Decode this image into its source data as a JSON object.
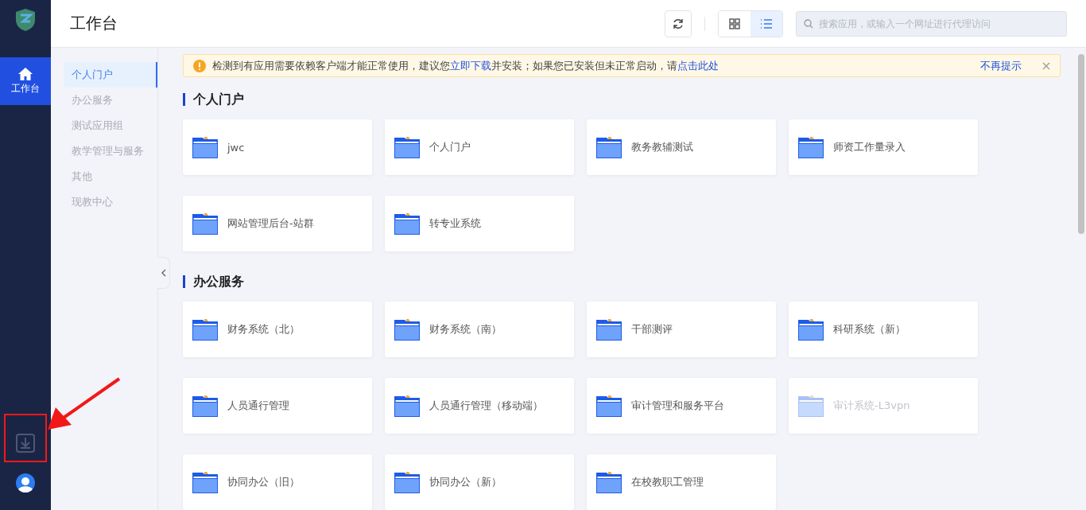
{
  "nav": {
    "items": [
      {
        "label": "工作台",
        "selected": true
      }
    ]
  },
  "header": {
    "title": "工作台",
    "search": {
      "placeholder": "搜索应用，或输入一个网址进行代理访问"
    },
    "views": [
      {
        "kind": "grid",
        "selected": false
      },
      {
        "kind": "list",
        "selected": true
      }
    ]
  },
  "categories": [
    {
      "label": "个人门户",
      "selected": true
    },
    {
      "label": "办公服务",
      "selected": false
    },
    {
      "label": "测试应用组",
      "selected": false
    },
    {
      "label": "教学管理与服务",
      "selected": false
    },
    {
      "label": "其他",
      "selected": false
    },
    {
      "label": "现教中心",
      "selected": false
    }
  ],
  "alert": {
    "text_1": "检测到有应用需要依赖客户端才能正常使用，建议您",
    "link_1": "立即下载",
    "text_2": "并安装；如果您已安装但未正常启动，请",
    "link_2": "点击此处",
    "dismiss": "不再提示"
  },
  "sections": [
    {
      "title": "个人门户",
      "apps": [
        {
          "name": "jwc",
          "disabled": false
        },
        {
          "name": "个人门户",
          "disabled": false
        },
        {
          "name": "教务教辅测试",
          "disabled": false
        },
        {
          "name": "师资工作量录入",
          "disabled": false
        },
        {
          "name": "网站管理后台-站群",
          "disabled": false
        },
        {
          "name": "转专业系统",
          "disabled": false
        }
      ]
    },
    {
      "title": "办公服务",
      "apps": [
        {
          "name": "财务系统（北）",
          "disabled": false
        },
        {
          "name": "财务系统（南）",
          "disabled": false
        },
        {
          "name": "干部测评",
          "disabled": false
        },
        {
          "name": "科研系统（新）",
          "disabled": false
        },
        {
          "name": "人员通行管理",
          "disabled": false
        },
        {
          "name": "人员通行管理（移动端）",
          "disabled": false
        },
        {
          "name": "审计管理和服务平台",
          "disabled": false
        },
        {
          "name": "审计系统-L3vpn",
          "disabled": true
        },
        {
          "name": "协同办公（旧）",
          "disabled": false
        },
        {
          "name": "协同办公（新）",
          "disabled": false
        },
        {
          "name": "在校教职工管理",
          "disabled": false
        }
      ]
    }
  ]
}
